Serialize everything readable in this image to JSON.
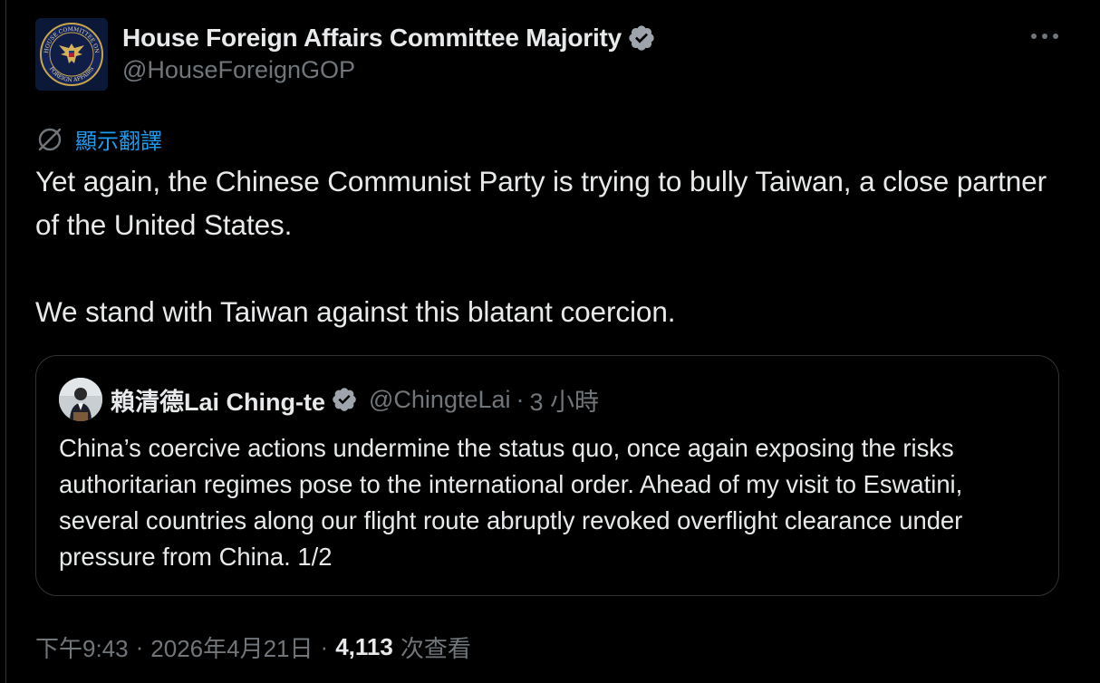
{
  "author": {
    "display_name": "House Foreign Affairs Committee Majority",
    "handle": "@HouseForeignGOP",
    "avatar_icon": "house-foreign-affairs-seal",
    "avatar_seal_text_top": "HOUSE COMMITTEE ON",
    "avatar_seal_text_bottom": "FOREIGN AFFAIRS",
    "verified_icon": "verified-badge-icon"
  },
  "more_icon": "ellipsis-icon",
  "translate": {
    "icon": "translate-globe-icon",
    "label": "顯示翻譯"
  },
  "tweet": {
    "paragraph_1": "Yet again, the Chinese Communist Party is trying to bully Taiwan, a close partner of the United States.",
    "paragraph_2": "We stand with Taiwan against this blatant coercion."
  },
  "quoted_tweet": {
    "display_name": "賴清德Lai Ching-te",
    "handle": "@ChingteLai",
    "separator": "·",
    "time": "3 小時",
    "text": "China’s coercive actions undermine the status quo, once again exposing the risks authoritarian regimes pose to the international order. Ahead of my visit to Eswatini, several countries along our flight route abruptly revoked overflight clearance under pressure from China. 1/2"
  },
  "meta": {
    "time": "下午9:43",
    "separator": "·",
    "date": "2026年4月21日",
    "views": "4,113",
    "views_label": "次查看"
  },
  "colors": {
    "background": "#000000",
    "text_primary": "#e7e9ea",
    "text_secondary": "#71767b",
    "accent": "#1d9bf0",
    "verified": "#9ea4ab",
    "border": "#2f3336"
  }
}
